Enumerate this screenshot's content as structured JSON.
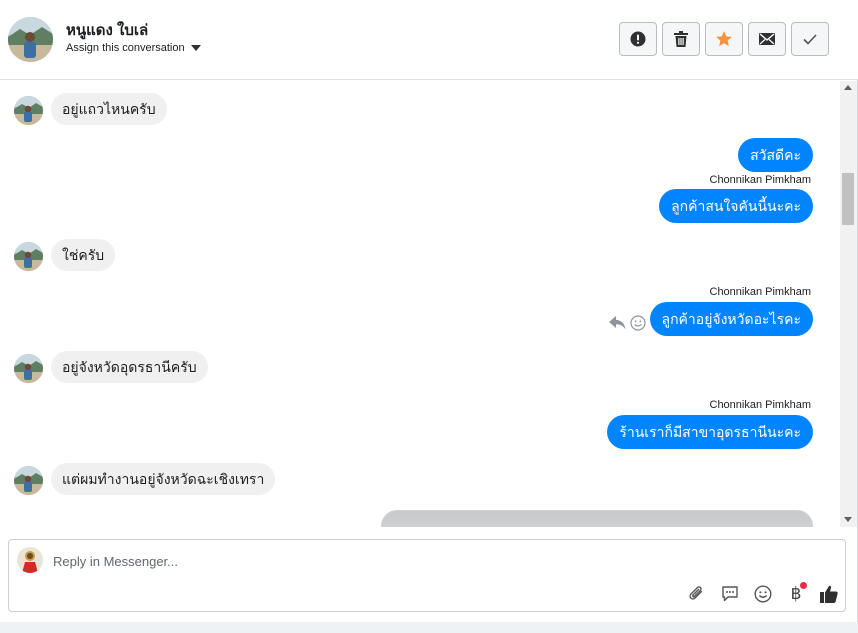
{
  "header": {
    "contact_name": "หนูแดง ใบเล่",
    "assign_label": "Assign this conversation",
    "actions": [
      {
        "name": "spam-button",
        "icon": "exclamation-icon"
      },
      {
        "name": "delete-button",
        "icon": "trash-icon"
      },
      {
        "name": "star-button",
        "icon": "star-icon",
        "color": "#f7923b"
      },
      {
        "name": "mark-unread-button",
        "icon": "envelope-icon"
      },
      {
        "name": "done-button",
        "icon": "checkmark-icon"
      }
    ]
  },
  "messages": [
    {
      "direction": "in",
      "text": "อยู่แถวไหนครับ"
    },
    {
      "direction": "out",
      "text": "สวัสดีคะ"
    },
    {
      "direction": "out",
      "sender": "Chonnikan Pimkham",
      "text": "ลูกค้าสนใจคันนี้นะคะ"
    },
    {
      "direction": "in",
      "text": "ใช่ครับ"
    },
    {
      "direction": "out",
      "sender": "Chonnikan Pimkham",
      "text": "ลูกค้าอยู่จังหวัดอะไรคะ"
    },
    {
      "direction": "in",
      "text": "อยู่จังหวัดอุดรธานีครับ"
    },
    {
      "direction": "out",
      "sender": "Chonnikan Pimkham",
      "text": "ร้านเราก็มีสาขาอุดรธานีนะคะ"
    },
    {
      "direction": "in",
      "text": "แต่ผมทำงานอยู่จังหวัดฉะเชิงเทรา"
    }
  ],
  "composer": {
    "placeholder": "Reply in Messenger...",
    "tools": [
      "paperclip-icon",
      "quick-reply-icon",
      "emoji-icon",
      "baht-payment-icon",
      "thumbs-up-icon"
    ],
    "baht_symbol": "฿"
  },
  "colors": {
    "outgoing_bubble": "#0084ff",
    "incoming_bubble": "#f0f0f0",
    "notification_dot": "#f02849"
  }
}
